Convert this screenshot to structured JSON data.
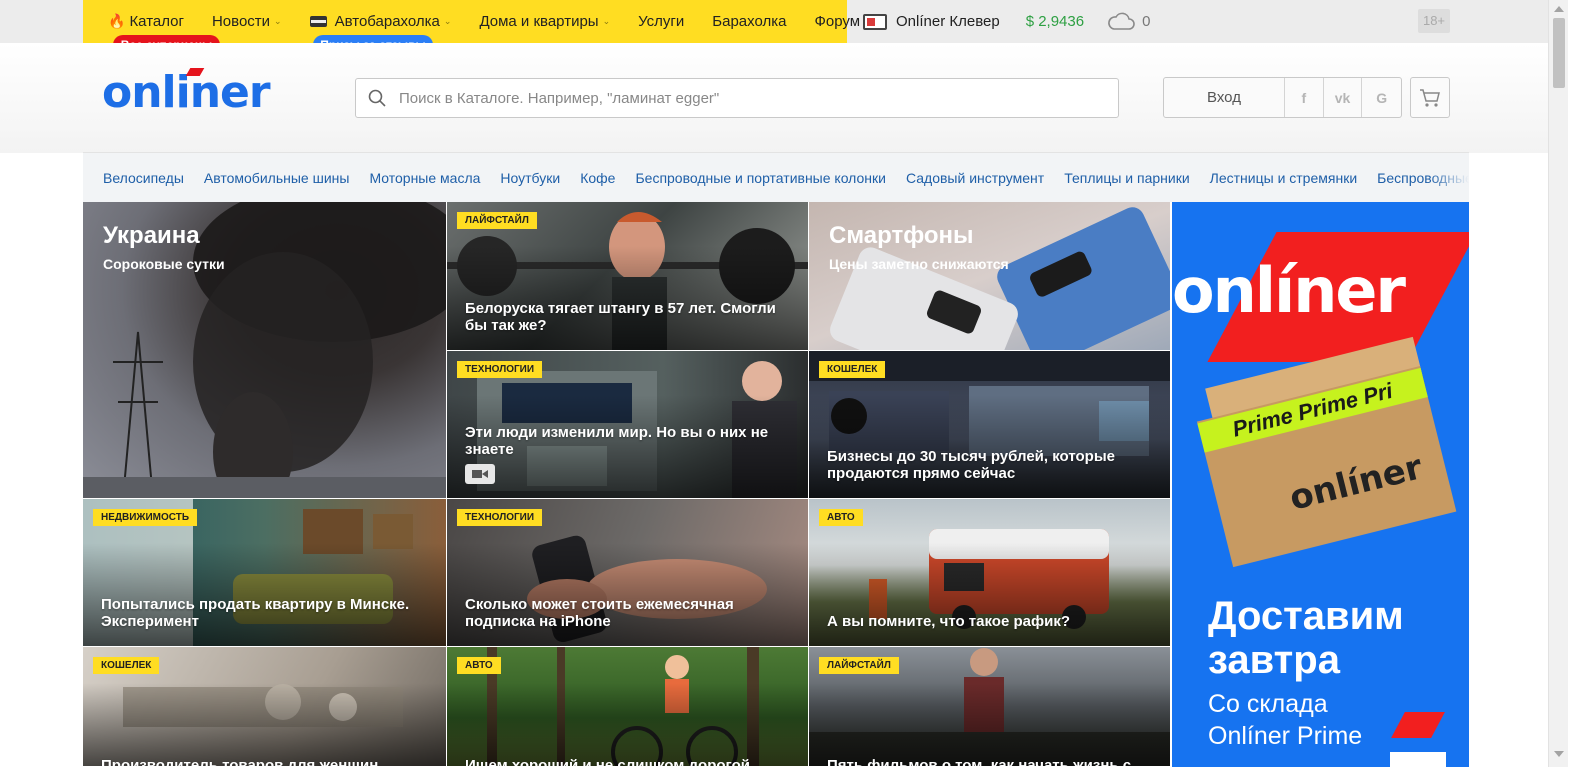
{
  "topnav": {
    "items": [
      {
        "label": "Каталог",
        "icon": "flame-icon",
        "has_chevron": false
      },
      {
        "label": "Новости",
        "has_chevron": true
      },
      {
        "label": "Автобарахолка",
        "icon": "car-card-icon",
        "has_chevron": true
      },
      {
        "label": "Дома и квартиры",
        "has_chevron": true
      },
      {
        "label": "Услуги",
        "has_chevron": false
      },
      {
        "label": "Барахолка",
        "has_chevron": false
      },
      {
        "label": "Форум",
        "has_chevron": false
      }
    ],
    "badge_catalog": "Все суперцены",
    "badge_auto": "Призы за отзывы",
    "clever": "Onlíner Клевер",
    "rate": "$ 2,9436",
    "weather_temp": "0",
    "age_limit": "18+"
  },
  "header": {
    "logo": "onliner",
    "search_placeholder": "Поиск в Каталоге. Например, \"ламинат egger\"",
    "login_label": "Вход",
    "social": [
      "f",
      "vk",
      "G"
    ]
  },
  "categories": [
    "Велосипеды",
    "Автомобильные шины",
    "Моторные масла",
    "Ноутбуки",
    "Кофе",
    "Беспроводные и портативные колонки",
    "Садовый инструмент",
    "Теплицы и парники",
    "Лестницы и стремянки",
    "Беспроводные ма"
  ],
  "news": {
    "feature": {
      "title": "Украина",
      "subtitle": "Сороковые сутки"
    },
    "smartphones": {
      "title": "Смартфоны",
      "subtitle": "Цены заметно снижаются"
    },
    "tiles": [
      {
        "tag": "Лайфстайл",
        "title": "Белоруска тягает штангу в 57 лет. Смогли бы так же?"
      },
      {
        "tag": "Технологии",
        "title": "Эти люди изменили мир. Но вы о них не знаете",
        "video": true
      },
      {
        "tag": "Кошелек",
        "title": "Бизнесы до 30 тысяч рублей, которые продаются прямо сейчас"
      },
      {
        "tag": "Недвижимость",
        "title": "Попытались продать квартиру в Минске. Эксперимент"
      },
      {
        "tag": "Технологии",
        "title": "Сколько может стоить ежемесячная подписка на iPhone"
      },
      {
        "tag": "Авто",
        "title": "А вы помните, что такое рафик?"
      },
      {
        "tag": "Кошелек",
        "title": "Производитель товаров для женщин"
      },
      {
        "tag": "Авто",
        "title": "Ищем хороший и не слишком дорогой"
      },
      {
        "tag": "Лайфстайл",
        "title": "Пять фильмов о том, как начать жизнь с"
      }
    ]
  },
  "ad": {
    "logo": "onlíner",
    "tape": "Prime Prime Pri",
    "box_logo": "onlíner",
    "headline_1": "Доставим",
    "headline_2": "завтра",
    "sub_1": "Со склада",
    "sub_2": "Onlíner Prime"
  },
  "colors": {
    "brand_yellow": "#ffdd22",
    "brand_blue": "#1d6ee6",
    "badge_red": "#e5131c",
    "badge_blue": "#2b7ef5",
    "rate_green": "#2ea043"
  }
}
